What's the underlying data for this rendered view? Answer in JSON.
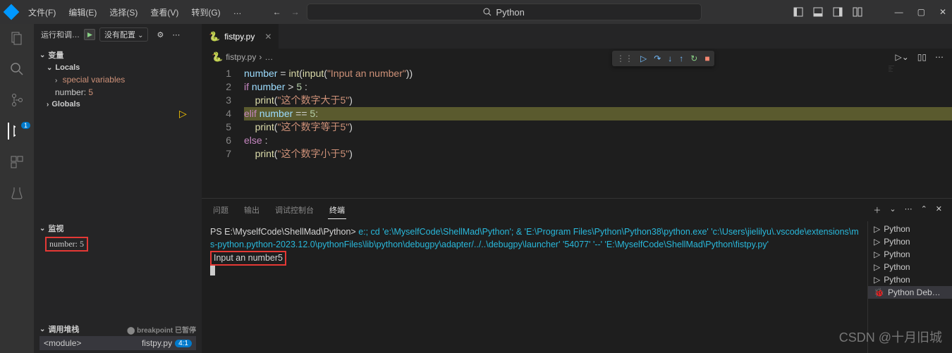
{
  "menu": [
    "文件(F)",
    "编辑(E)",
    "选择(S)",
    "查看(V)",
    "转到(G)",
    "…"
  ],
  "search_text": "Python",
  "sidebar": {
    "run_label": "运行和调…",
    "config": "没有配置",
    "variables": "变量",
    "locals": "Locals",
    "special": "special variables",
    "number_key": "number",
    "number_val": "5",
    "globals": "Globals",
    "watch": "监视",
    "watch_text": "number: 5",
    "callstack": "调用堆栈",
    "paused": "⬤ breakpoint 已暂停",
    "cs_func": "<module>",
    "cs_file": "fistpy.py",
    "cs_line": "4:1"
  },
  "tab": "fistpy.py",
  "breadcrumb": [
    "fistpy.py",
    "…"
  ],
  "code": {
    "l1": [
      "number",
      " = ",
      "int",
      "(",
      "input",
      "(",
      "\"Input an number\"",
      "))"
    ],
    "l2": [
      "if ",
      "number",
      " > ",
      "5",
      " :"
    ],
    "l3": [
      "    ",
      "print",
      "(",
      "\"这个数字大于5\"",
      ")"
    ],
    "l4": [
      "elif ",
      "number",
      " == ",
      "5",
      ":"
    ],
    "l5": [
      "    ",
      "print",
      "(",
      "\"这个数字等于5\"",
      ")"
    ],
    "l6": [
      "else",
      " :"
    ],
    "l7": [
      "    ",
      "print",
      "(",
      "\"这个数字小于5\"",
      ")"
    ]
  },
  "line_nums": [
    "1",
    "2",
    "3",
    "4",
    "5",
    "6",
    "7"
  ],
  "panel_tabs": [
    "问题",
    "输出",
    "调试控制台",
    "终端"
  ],
  "terminal": {
    "prompt_path": "PS E:\\MyselfCode\\ShellMad\\Python> ",
    "cmd1": "e:; cd 'e:\\MyselfCode\\ShellMad\\Python'; & 'E:\\Program Files\\Python\\Python38\\python.exe' 'c:\\Users\\jielilyu\\.vscode\\extensions\\ms-python.python-2023.12.0\\pythonFiles\\lib\\python\\debugpy\\adapter/../..\\debugpy\\launcher' '54077' '--' 'E:\\MyselfCode\\ShellMad\\Python\\fistpy.py'",
    "input_line": "Input an number5"
  },
  "term_list": [
    "Python",
    "Python",
    "Python",
    "Python",
    "Python",
    "Python Deb…"
  ],
  "watermark": "CSDN @十月旧城"
}
